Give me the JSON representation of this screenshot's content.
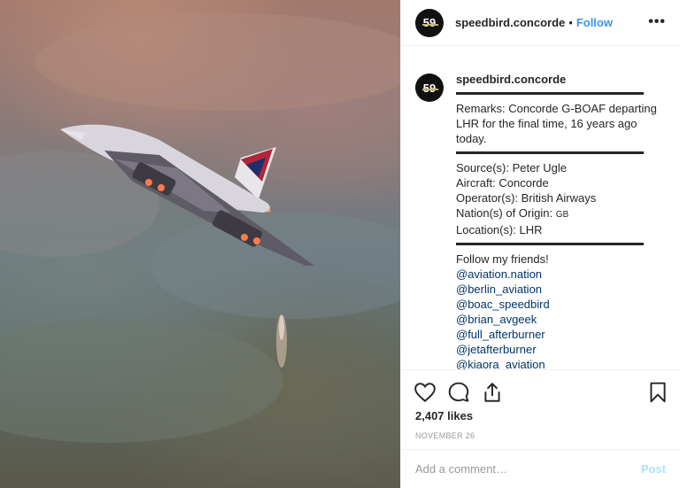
{
  "photo": {
    "alt_subject": "concorde-departing"
  },
  "header": {
    "avatar_text": "59",
    "username": "speedbird.concorde",
    "separator": "•",
    "follow_label": "Follow",
    "more_label": "•••"
  },
  "caption": {
    "username": "speedbird.concorde",
    "remarks": "Remarks: Concorde G-BOAF departing LHR for the final time, 16 years ago today.",
    "source": "Source(s): Peter Ugle",
    "aircraft": "Aircraft: Concorde",
    "operator": "Operator(s): British Airways",
    "origin_prefix": "Nation(s) of Origin: ",
    "origin_code": "GB",
    "location": "Location(s): LHR",
    "follow_intro": "Follow my friends!",
    "mentions": [
      "@aviation.nation",
      "@berlin_aviation",
      "@boac_speedbird",
      "@brian_avgeek",
      "@full_afterburner",
      "@jetafterburner",
      "@kiaora_aviation"
    ]
  },
  "actions": {
    "likes": "2,407 likes",
    "date": "NOVEMBER 26"
  },
  "comment": {
    "placeholder": "Add a comment…",
    "post_label": "Post"
  },
  "colors": {
    "accent": "#3897f0",
    "post_disabled": "#b2dffc",
    "mention": "#003569"
  }
}
